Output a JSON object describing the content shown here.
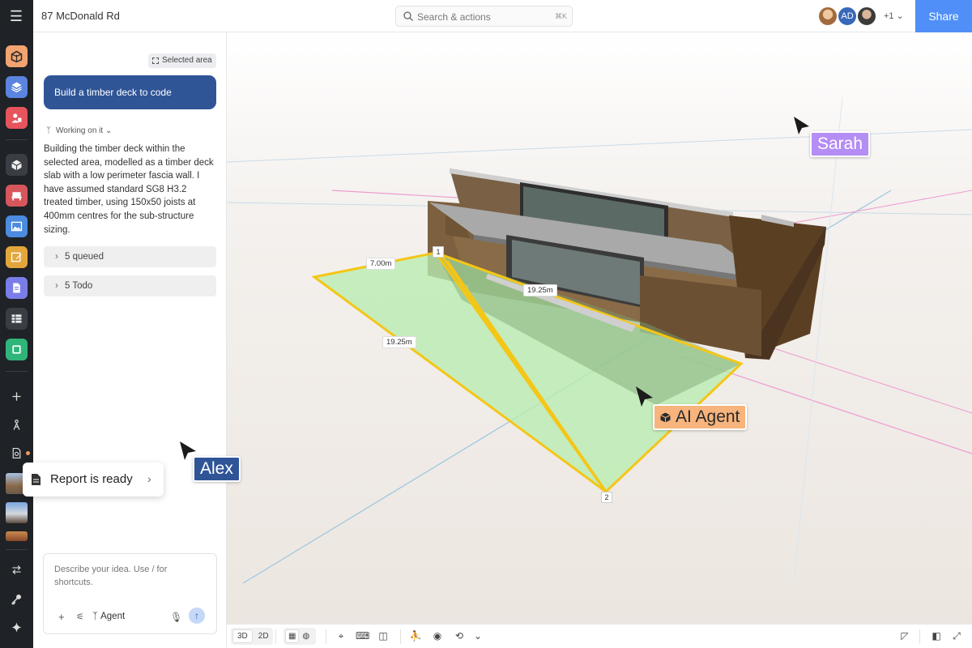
{
  "topbar": {
    "doc_title": "87 McDonald Rd",
    "search_placeholder": "Search & actions",
    "search_shortcut": "⌘K",
    "avatar_initials": "AD",
    "avatar_more": "+1",
    "share_label": "Share"
  },
  "rail": {
    "icons": [
      "home-icon",
      "layers-icon",
      "people-icon",
      "cube-icon",
      "furniture-icon",
      "image-icon",
      "edit-icon",
      "document-icon",
      "table-icon",
      "frame-icon",
      "plus-icon",
      "agent-icon",
      "report-icon",
      "swap-icon",
      "key-icon",
      "sparkle-icon"
    ]
  },
  "chat": {
    "selected_area_label": "Selected area",
    "user_message": "Build a timber deck to code",
    "status": "Working on it",
    "reply": "Building the timber deck within the selected area, modelled as a timber deck slab with a low perimeter fascia wall. I have assumed standard SG8 H3.2 treated timber, using 150x50 joists at 400mm centres for the sub-structure sizing.",
    "queued_label": "5 queued",
    "todo_label": "5 Todo",
    "composer_placeholder": "Describe your idea. Use / for shortcuts.",
    "agent_label": "Agent"
  },
  "toast": {
    "text": "Report is ready"
  },
  "viewport": {
    "dimensions": {
      "top_edge": "7.00m",
      "left_edge": "19.25m",
      "front_edge": "19.25m"
    },
    "points": [
      "1",
      "2"
    ],
    "cursors": {
      "sarah": "Sarah",
      "agent": "AI Agent",
      "alex": "Alex"
    },
    "colors": {
      "sarah": "#b48df5",
      "agent": "#f7b47c",
      "alex": "#2f5597",
      "selection_outline": "#f4c617",
      "selection_fill": "#b8ecb0",
      "share_button": "#4f8ff7"
    }
  },
  "bottombar": {
    "mode_3d": "3D",
    "mode_2d": "2D"
  }
}
